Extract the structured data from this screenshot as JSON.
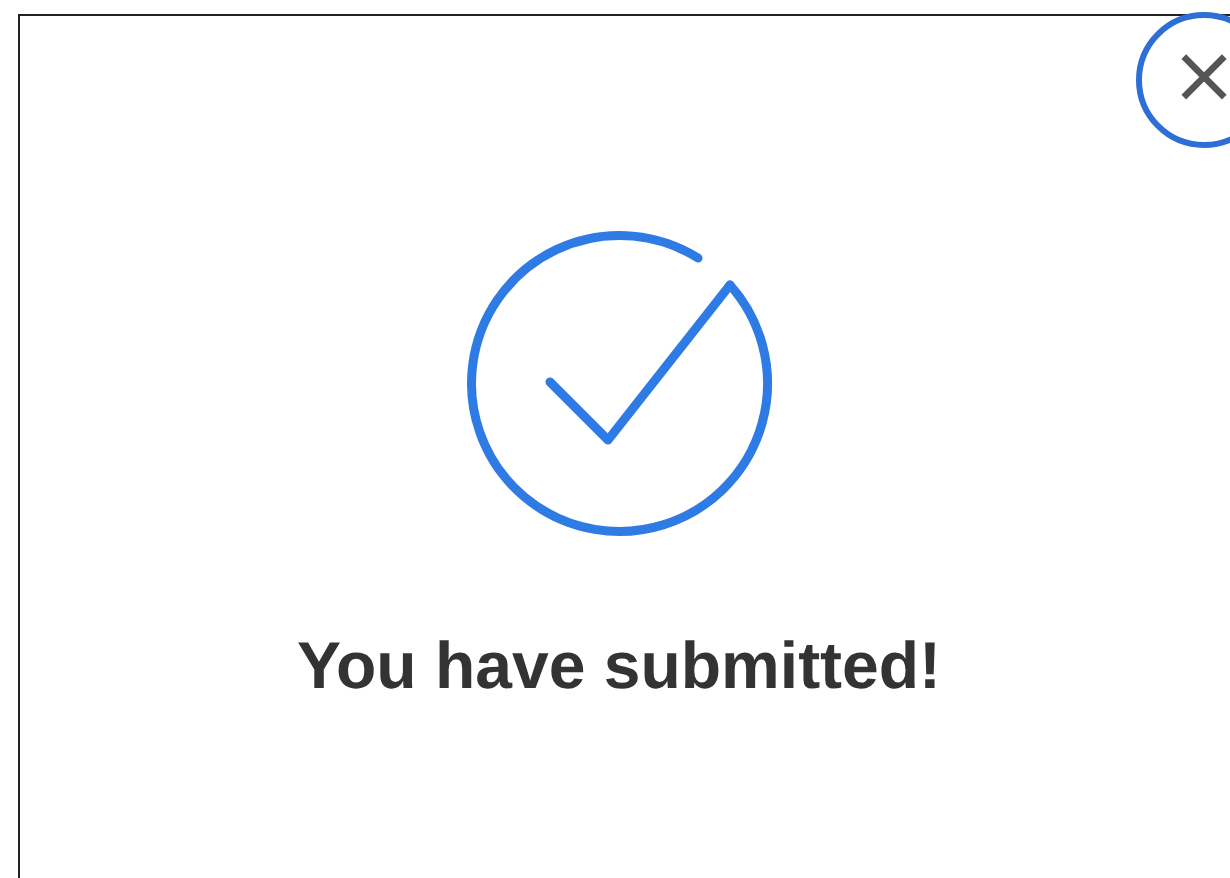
{
  "dialog": {
    "message": "You have submitted!",
    "close_label": "×"
  }
}
